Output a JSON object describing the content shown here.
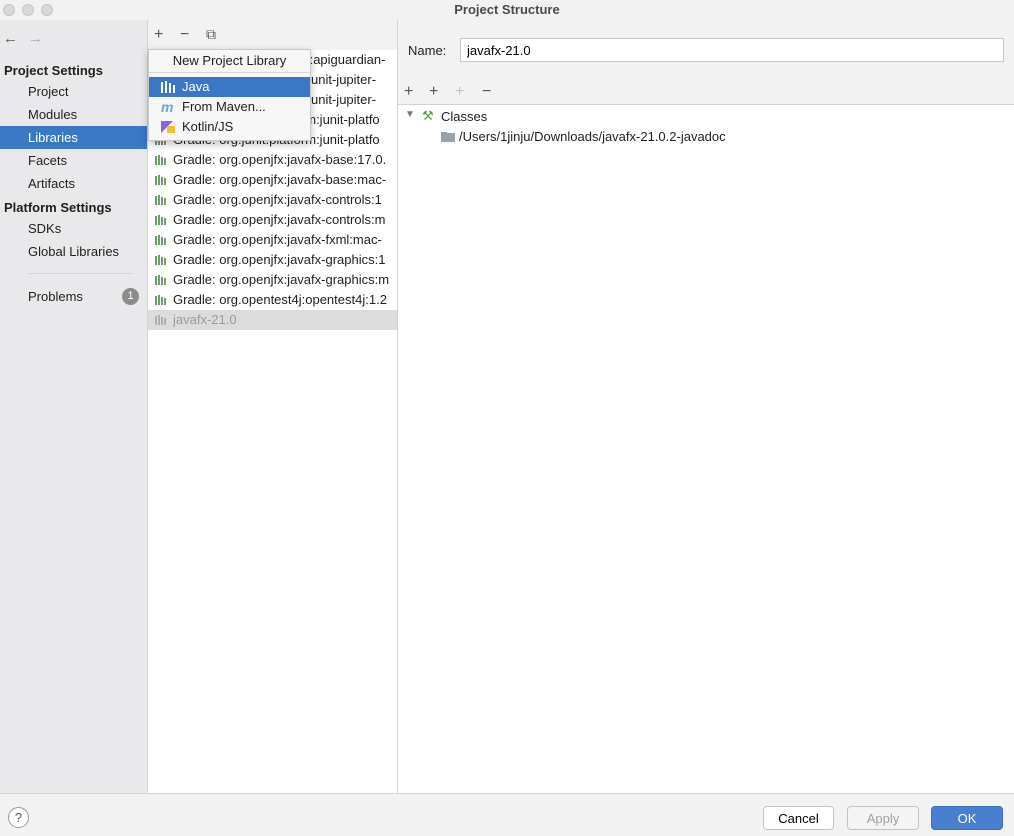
{
  "window": {
    "title": "Project Structure"
  },
  "nav": {
    "back_icon": "←",
    "forward_icon": "→"
  },
  "sidebar": {
    "project_settings_label": "Project Settings",
    "project_items": [
      "Project",
      "Modules",
      "Libraries",
      "Facets",
      "Artifacts"
    ],
    "selected_item": "Libraries",
    "platform_settings_label": "Platform Settings",
    "platform_items": [
      "SDKs",
      "Global Libraries"
    ],
    "problems_label": "Problems",
    "problems_count": "1"
  },
  "library_toolbar": {
    "add": "+",
    "remove": "−",
    "copy": "⧉"
  },
  "libraries": [
    "Gradle: org.apiguardian:apiguardian-",
    "Gradle: org.junit.jupiter:junit-jupiter-",
    "Gradle: org.junit.jupiter:junit-jupiter-",
    "Gradle: org.junit.platform:junit-platfo",
    "Gradle: org.junit.platform:junit-platfo",
    "Gradle: org.openjfx:javafx-base:17.0.",
    "Gradle: org.openjfx:javafx-base:mac-",
    "Gradle: org.openjfx:javafx-controls:1",
    "Gradle: org.openjfx:javafx-controls:m",
    "Gradle: org.openjfx:javafx-fxml:mac-",
    "Gradle: org.openjfx:javafx-graphics:1",
    "Gradle: org.openjfx:javafx-graphics:m",
    "Gradle: org.opentest4j:opentest4j:1.2",
    "javafx-21.0"
  ],
  "selected_library": "javafx-21.0",
  "popup": {
    "header": "New Project Library",
    "items": [
      "Java",
      "From Maven...",
      "Kotlin/JS"
    ],
    "selected": "Java"
  },
  "detail": {
    "name_label": "Name:",
    "name_value": "javafx-21.0",
    "toolbar": {
      "add": "+",
      "add_alt": "+",
      "add_disabled": "+",
      "remove": "−"
    },
    "tree": {
      "root_label": "Classes",
      "child_path": "/Users/1jinju/Downloads/javafx-21.0.2-javadoc"
    }
  },
  "footer": {
    "help": "?",
    "cancel": "Cancel",
    "apply": "Apply",
    "ok": "OK"
  },
  "colors": {
    "accent": "#3b78c4",
    "ok_button": "#4a7fd0",
    "badge": "#8c8c8c"
  }
}
